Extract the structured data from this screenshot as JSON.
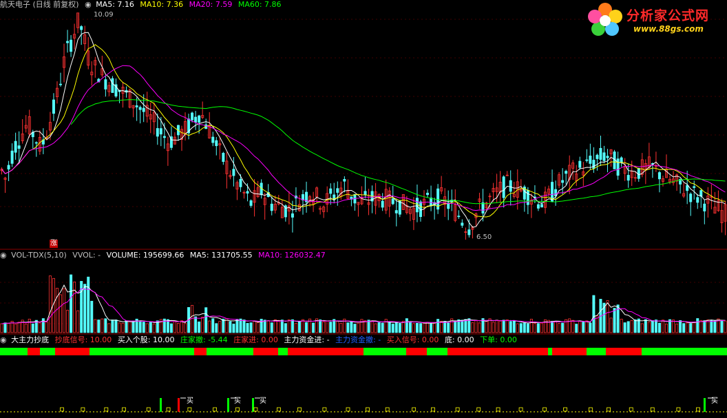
{
  "main_header": {
    "title": "航天电子 (日线 前复权)",
    "ma5": "MA5: 7.16",
    "ma10": "MA10: 7.36",
    "ma20": "MA20: 7.59",
    "ma60": "MA60: 7.86"
  },
  "main_annotations": {
    "high": "10.09",
    "low": "6.50",
    "limit_up": "涨"
  },
  "volume_header": {
    "name": "VOL-TDX(5,10)",
    "vvol": "VVOL: -",
    "volume": "VOLUME: 195699.66",
    "ma5": "MA5: 131705.55",
    "ma10": "MA10: 126032.47"
  },
  "indicator_header": {
    "name": "大主力抄底",
    "signal": "抄底信号: 10.00",
    "buy_stock": "买入个股: 10.00",
    "dealer_out": "庄家撤: -5.44",
    "dealer_in": "庄家进: 0.00",
    "main_fund_in": "主力资金进: -",
    "main_fund_out": "主力资金撤: -",
    "buy_signal": "买入信号: 0.00",
    "bottom": "底: 0.00",
    "order": "下单: 0.00"
  },
  "buy_marks": {
    "label": "买"
  },
  "watermark": {
    "title": "分析家公式网",
    "url": "www.88gs.com"
  },
  "colors": {
    "background": "#000000",
    "up": "#ff3232",
    "down": "#54fcfc",
    "ma5": "#ffffff",
    "ma10": "#ffff00",
    "ma20": "#ff00ff",
    "ma60": "#00ff00",
    "grid": "#8b0000",
    "bar_green": "#00ff00",
    "bar_red": "#ff0000"
  },
  "chart_data": {
    "type": "candlestick",
    "price_high": 10.09,
    "price_low": 6.5,
    "volume_current": 195699.66,
    "volume_ma5": 131705.55,
    "volume_ma10": 126032.47
  }
}
